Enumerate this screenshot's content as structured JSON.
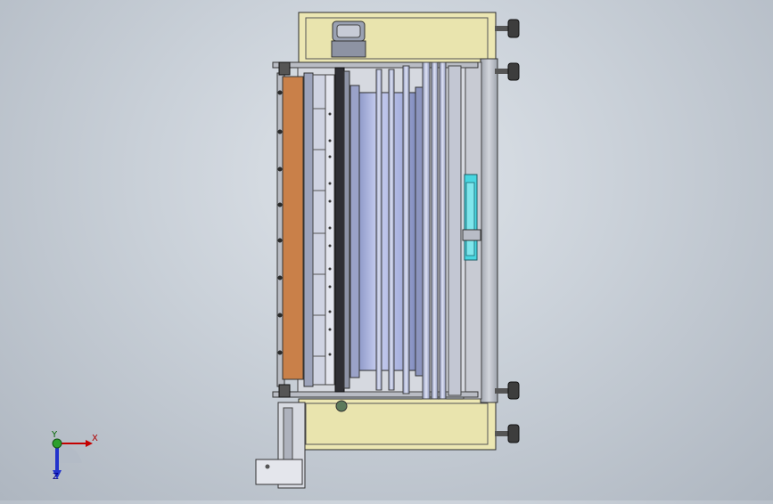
{
  "triad": {
    "x_label": "X",
    "y_label": "Y",
    "z_label": "Z"
  },
  "colors": {
    "background": "#c9d0d8",
    "housing_fill": "#ece7b3",
    "frame_gray": "#b9bcc4",
    "belt_orange": "#c98049",
    "roller_blue": "#b7c1e4",
    "cylinder_shade": "#8e99c6",
    "dark_bar": "#3a3a3a",
    "cyan_part": "#48d6e0",
    "outline": "#2b2b2b"
  },
  "icons": {
    "triad": "coordinate-axes-icon"
  }
}
